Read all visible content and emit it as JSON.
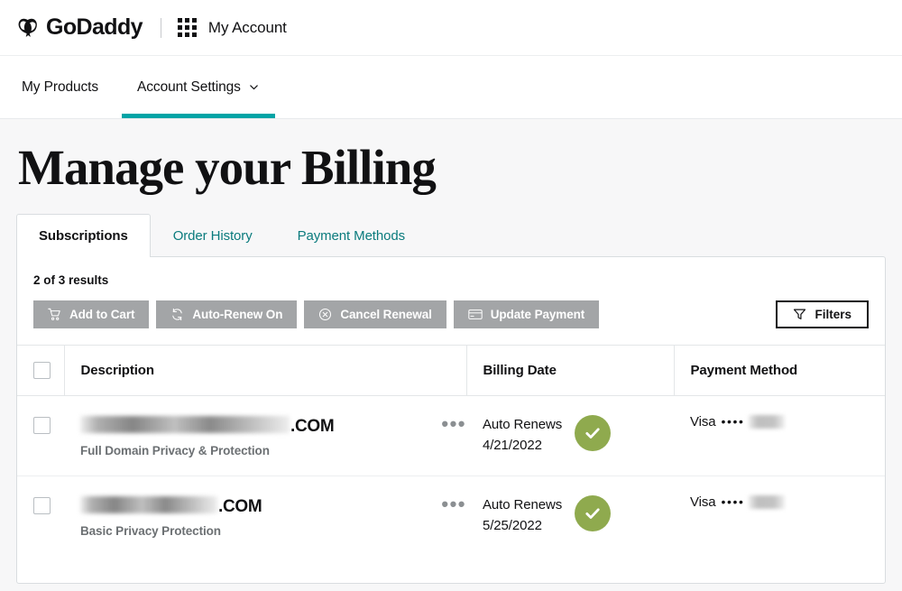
{
  "brand": {
    "logo_icon": "godaddy-heart-logo-icon",
    "name": "GoDaddy",
    "divider": "|",
    "grid_icon": "apps-grid-icon",
    "account_label": "My Account"
  },
  "nav": {
    "items": [
      {
        "label": "My Products",
        "active": false,
        "has_caret": false
      },
      {
        "label": "Account Settings",
        "active": true,
        "has_caret": true,
        "caret_icon": "chevron-down-icon"
      }
    ]
  },
  "page": {
    "title": "Manage your Billing"
  },
  "tabs": [
    {
      "label": "Subscriptions",
      "active": true
    },
    {
      "label": "Order History",
      "active": false
    },
    {
      "label": "Payment Methods",
      "active": false
    }
  ],
  "toolbar": {
    "results_text": "2 of 3 results",
    "buttons": [
      {
        "label": "Add to Cart",
        "icon": "shopping-cart-icon",
        "disabled": true
      },
      {
        "label": "Auto-Renew On",
        "icon": "refresh-cycle-icon",
        "disabled": true
      },
      {
        "label": "Cancel Renewal",
        "icon": "circle-x-icon",
        "disabled": true
      },
      {
        "label": "Update Payment",
        "icon": "credit-card-icon",
        "disabled": true
      }
    ],
    "filters": {
      "label": "Filters",
      "icon": "funnel-filter-icon"
    }
  },
  "table": {
    "headers": {
      "select_all": "",
      "description": "Description",
      "billing_date": "Billing Date",
      "payment_method": "Payment Method"
    },
    "rows": [
      {
        "domain_redacted": true,
        "domain_redact_width": 232,
        "domain_tld": ".COM",
        "product": "Full Domain Privacy & Protection",
        "overflow_menu": "•••",
        "billing_status": "Auto Renews",
        "billing_date": "4/21/2022",
        "status_icon": "green-check-circle-icon",
        "payment_brand": "Visa",
        "payment_bullets": "••••",
        "payment_last4_redacted": true
      },
      {
        "domain_redacted": true,
        "domain_redact_width": 152,
        "domain_tld": ".COM",
        "product": "Basic Privacy Protection",
        "overflow_menu": "•••",
        "billing_status": "Auto Renews",
        "billing_date": "5/25/2022",
        "status_icon": "green-check-circle-icon",
        "payment_brand": "Visa",
        "payment_bullets": "••••",
        "payment_last4_redacted": true
      }
    ]
  },
  "colors": {
    "accent_teal": "#00a4a6",
    "link_teal": "#0a7b7d",
    "status_green": "#8faa4e",
    "disabled_gray": "#a3a5a7",
    "page_bg": "#f7f7f8",
    "text_dark": "#111113"
  }
}
